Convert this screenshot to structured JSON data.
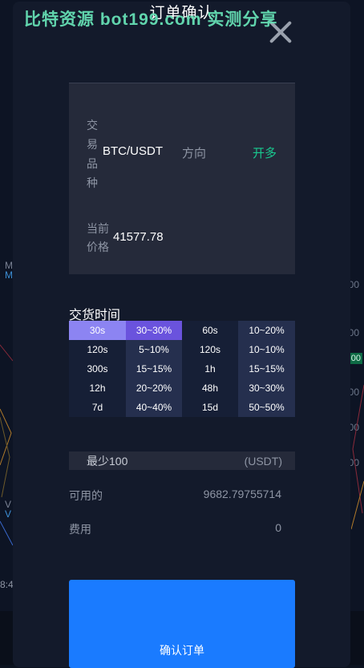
{
  "background": {
    "right_labels": [
      "00",
      "00",
      "00",
      "00",
      "00"
    ],
    "right_tag": "00",
    "left_labels": [
      "M",
      "M",
      "V",
      "V",
      "8:4"
    ]
  },
  "watermark": "比特资源 bot199.com 实测分享",
  "modal": {
    "title": "订单确认",
    "close_icon": "close-icon"
  },
  "info": {
    "pair_label": "交易品种",
    "pair_value": "BTC/USDT",
    "direction_label": "方向",
    "direction_value": "开多",
    "direction_color": "#19c98f",
    "price_label": "当前价格",
    "price_value": "41577.78"
  },
  "delivery": {
    "title": "交货时间",
    "rows": [
      [
        "30s",
        "30~30%",
        "60s",
        "10~20%"
      ],
      [
        "120s",
        "5~10%",
        "120s",
        "10~10%"
      ],
      [
        "300s",
        "15~15%",
        "1h",
        "15~15%"
      ],
      [
        "12h",
        "20~20%",
        "48h",
        "30~30%"
      ],
      [
        "7d",
        "40~40%",
        "15d",
        "50~50%"
      ]
    ],
    "selected_row": 0,
    "selected_color_time": "#8c84f2",
    "selected_color_rate": "#6a53dd"
  },
  "amount": {
    "placeholder": "最少100",
    "unit": "(USDT)"
  },
  "available": {
    "label": "可用的",
    "value": "9682.79755714"
  },
  "fee": {
    "label": "费用",
    "value": "0"
  },
  "confirm_button": {
    "label": "确认订单",
    "color": "#1a7bff"
  }
}
